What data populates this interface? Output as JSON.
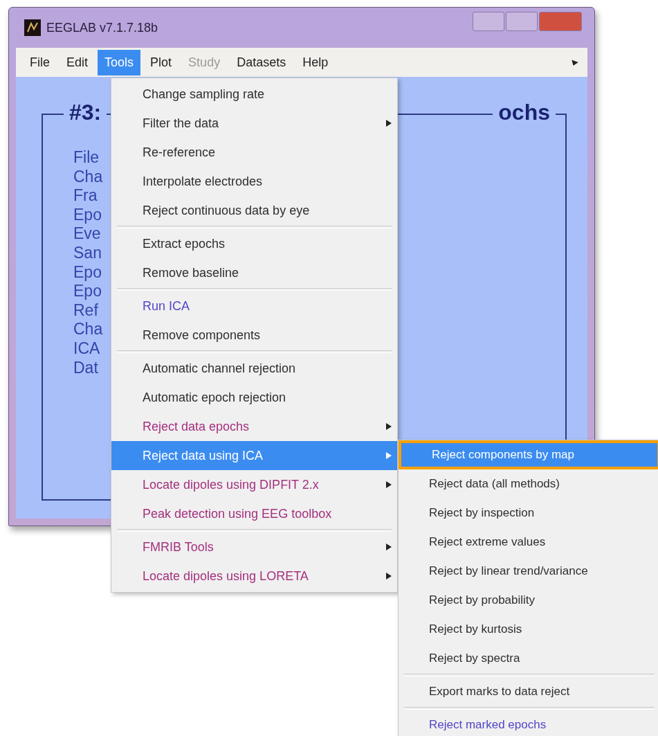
{
  "window": {
    "title": "EEGLAB v7.1.7.18b"
  },
  "menubar": [
    {
      "label": "File",
      "selected": false,
      "disabled": false
    },
    {
      "label": "Edit",
      "selected": false,
      "disabled": false
    },
    {
      "label": "Tools",
      "selected": true,
      "disabled": false
    },
    {
      "label": "Plot",
      "selected": false,
      "disabled": false
    },
    {
      "label": "Study",
      "selected": false,
      "disabled": true
    },
    {
      "label": "Datasets",
      "selected": false,
      "disabled": false
    },
    {
      "label": "Help",
      "selected": false,
      "disabled": false
    }
  ],
  "panel": {
    "title_start": "#3:",
    "title_end": "ochs",
    "labels": [
      "File",
      "Cha",
      "Fra",
      "Epo",
      "Eve",
      "San",
      "Epo",
      "Epo",
      "Ref",
      "Cha",
      "ICA",
      "Dat"
    ]
  },
  "tools_menu": [
    [
      {
        "label": "Change sampling rate",
        "kind": "normal",
        "submenu": false,
        "selected": false
      },
      {
        "label": "Filter the data",
        "kind": "normal",
        "submenu": true,
        "selected": false
      },
      {
        "label": "Re-reference",
        "kind": "normal",
        "submenu": false,
        "selected": false
      },
      {
        "label": "Interpolate electrodes",
        "kind": "normal",
        "submenu": false,
        "selected": false
      },
      {
        "label": "Reject continuous data by eye",
        "kind": "normal",
        "submenu": false,
        "selected": false
      }
    ],
    [
      {
        "label": "Extract epochs",
        "kind": "normal",
        "submenu": false,
        "selected": false
      },
      {
        "label": "Remove baseline",
        "kind": "normal",
        "submenu": false,
        "selected": false
      }
    ],
    [
      {
        "label": "Run ICA",
        "kind": "ica",
        "submenu": false,
        "selected": false
      },
      {
        "label": "Remove components",
        "kind": "normal",
        "submenu": false,
        "selected": false
      }
    ],
    [
      {
        "label": "Automatic channel rejection",
        "kind": "normal",
        "submenu": false,
        "selected": false
      },
      {
        "label": "Automatic epoch rejection",
        "kind": "normal",
        "submenu": false,
        "selected": false
      },
      {
        "label": "Reject data epochs",
        "kind": "plugin",
        "submenu": true,
        "selected": false
      },
      {
        "label": "Reject data using ICA",
        "kind": "plugin",
        "submenu": true,
        "selected": true
      },
      {
        "label": "Locate dipoles using DIPFIT 2.x",
        "kind": "plugin",
        "submenu": true,
        "selected": false
      },
      {
        "label": "Peak detection using EEG toolbox",
        "kind": "plugin",
        "submenu": false,
        "selected": false
      }
    ],
    [
      {
        "label": "FMRIB Tools",
        "kind": "plugin",
        "submenu": true,
        "selected": false
      },
      {
        "label": "Locate dipoles using LORETA",
        "kind": "plugin",
        "submenu": true,
        "selected": false
      }
    ]
  ],
  "ica_submenu": [
    [
      {
        "label": "Reject components by map",
        "kind": "normal",
        "selected": true,
        "outlined": true
      },
      {
        "label": "Reject data (all methods)",
        "kind": "normal",
        "selected": false,
        "outlined": false
      },
      {
        "label": "Reject by inspection",
        "kind": "normal",
        "selected": false,
        "outlined": false
      },
      {
        "label": "Reject extreme values",
        "kind": "normal",
        "selected": false,
        "outlined": false
      },
      {
        "label": "Reject by linear trend/variance",
        "kind": "normal",
        "selected": false,
        "outlined": false
      },
      {
        "label": "Reject by probability",
        "kind": "normal",
        "selected": false,
        "outlined": false
      },
      {
        "label": "Reject by kurtosis",
        "kind": "normal",
        "selected": false,
        "outlined": false
      },
      {
        "label": "Reject by spectra",
        "kind": "normal",
        "selected": false,
        "outlined": false
      }
    ],
    [
      {
        "label": "Export marks to data reject",
        "kind": "normal",
        "selected": false,
        "outlined": false
      }
    ],
    [
      {
        "label": "Reject marked epochs",
        "kind": "ica",
        "selected": false,
        "outlined": false
      }
    ]
  ]
}
